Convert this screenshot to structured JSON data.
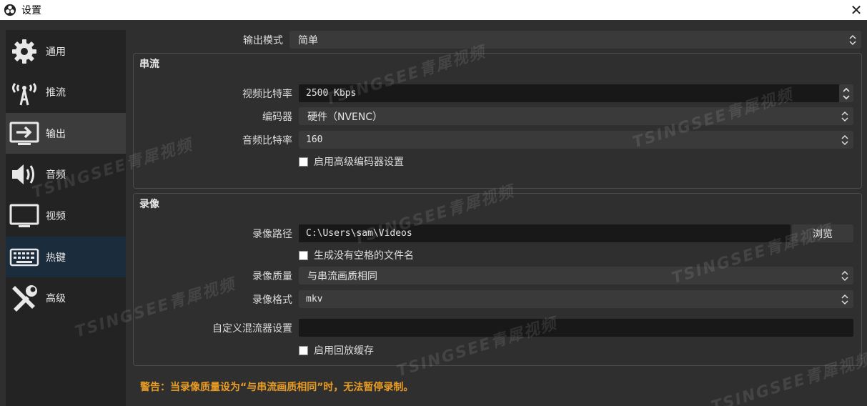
{
  "window": {
    "title": "设置"
  },
  "sidebar": {
    "items": [
      {
        "label": "通用",
        "icon": "gear-icon"
      },
      {
        "label": "推流",
        "icon": "broadcast-tower-icon"
      },
      {
        "label": "输出",
        "icon": "output-monitor-icon"
      },
      {
        "label": "音频",
        "icon": "speaker-icon"
      },
      {
        "label": "视频",
        "icon": "monitor-icon"
      },
      {
        "label": "热键",
        "icon": "keyboard-icon"
      },
      {
        "label": "高级",
        "icon": "tools-icon"
      }
    ]
  },
  "output_mode": {
    "label": "输出模式",
    "value": "简单"
  },
  "streaming": {
    "title": "串流",
    "video_bitrate": {
      "label": "视频比特率",
      "value": "2500 Kbps"
    },
    "encoder": {
      "label": "编码器",
      "value": "硬件（NVENC）"
    },
    "audio_bitrate": {
      "label": "音频比特率",
      "value": "160"
    },
    "advanced_checkbox": "启用高级编码器设置"
  },
  "recording": {
    "title": "录像",
    "path": {
      "label": "录像路径",
      "value": "C:\\Users\\sam\\Videos",
      "browse": "浏览"
    },
    "no_space_checkbox": "生成没有空格的文件名",
    "quality": {
      "label": "录像质量",
      "value": "与串流画质相同"
    },
    "format": {
      "label": "录像格式",
      "value": "mkv"
    },
    "muxer": {
      "label": "自定义混流器设置",
      "value": ""
    },
    "replay_checkbox": "启用回放缓存"
  },
  "warning": "警告：当录像质量设为“与串流画质相同”时，无法暂停录制。",
  "watermark": "TSINGSEE青犀视频",
  "colors": {
    "warning": "#e89c23",
    "active_item": "#3c3c3c",
    "hotkey_item": "#1b2c3c"
  }
}
